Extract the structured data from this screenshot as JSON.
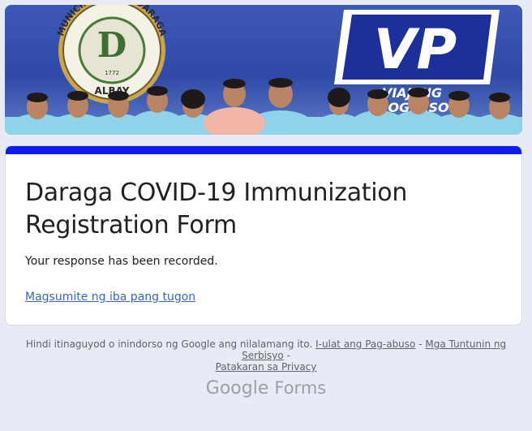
{
  "banner": {
    "seal_text": "MUNICIPALITY OF DARAGA",
    "seal_bottom": "ALBAY",
    "seal_year": "1772",
    "seal_letter": "D",
    "logo_letters": "VP",
    "slogan_line1": "VIAJENG",
    "slogan_line2": "PROGRESO",
    "colors": {
      "navy": "#2f4aa6",
      "shirt": "#8fd3e8",
      "logo_blue": "#1c2f9a"
    }
  },
  "form": {
    "title": "Daraga COVID-19 Immunization Registration Form",
    "message": "Your response has been recorded.",
    "submit_another": "Magsumite ng iba pang tugon",
    "accent_color": "#0d1cf0"
  },
  "footer": {
    "disclaimer": "Hindi itinaguyod o inindorso ng Google ang nilalamang ito.",
    "report_abuse": "I-ulat ang Pag-abuso",
    "terms": "Mga Tuntunin ng Serbisyo",
    "privacy": "Patakaran sa Privacy",
    "sep": " - ",
    "brand_google": "Google",
    "brand_forms": "Forms"
  }
}
